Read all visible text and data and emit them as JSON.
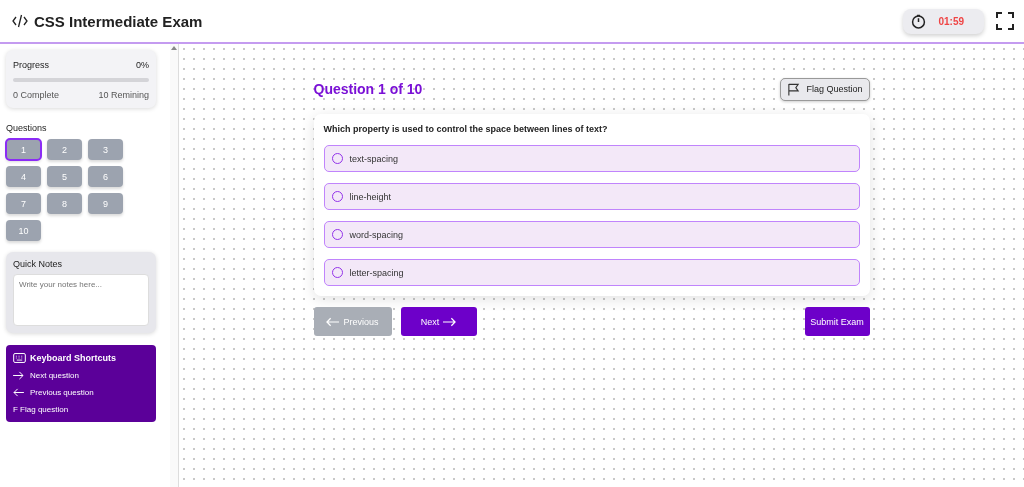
{
  "header": {
    "title": "CSS Intermediate Exam",
    "timer": "01:59"
  },
  "progress": {
    "label": "Progress",
    "percent": "0%",
    "level": 0,
    "complete": "0 Complete",
    "remaining": "10 Remining"
  },
  "questions_nav": {
    "label": "Questions",
    "items": [
      {
        "label": "1",
        "selected": true
      },
      {
        "label": "2",
        "selected": false
      },
      {
        "label": "3",
        "selected": false
      },
      {
        "label": "4",
        "selected": false
      },
      {
        "label": "5",
        "selected": false
      },
      {
        "label": "6",
        "selected": false
      },
      {
        "label": "7",
        "selected": false
      },
      {
        "label": "8",
        "selected": false
      },
      {
        "label": "9",
        "selected": false
      },
      {
        "label": "10",
        "selected": false
      }
    ]
  },
  "notes": {
    "label": "Quick Notes",
    "placeholder": "Write your notes here..."
  },
  "shortcuts": {
    "title": "Keyboard Shortcuts",
    "items": [
      {
        "kind": "arrow-right",
        "label": "Next question"
      },
      {
        "kind": "arrow-left",
        "label": "Previous question"
      },
      {
        "kind": "text",
        "label": "F Flag question"
      }
    ]
  },
  "question": {
    "heading": "Question 1 of 10",
    "flag_button": "Flag Question",
    "text": "Which property is used to control the space between lines of text?",
    "options": [
      {
        "label": "text-spacing",
        "checked": false
      },
      {
        "label": "line-height",
        "checked": false
      },
      {
        "label": "word-spacing",
        "checked": false
      },
      {
        "label": "letter-spacing",
        "checked": false
      }
    ]
  },
  "buttons": {
    "previous": {
      "label": "Previous",
      "disabled": true
    },
    "next": {
      "label": "Next",
      "disabled": false
    },
    "submit": "Submit Exam"
  }
}
